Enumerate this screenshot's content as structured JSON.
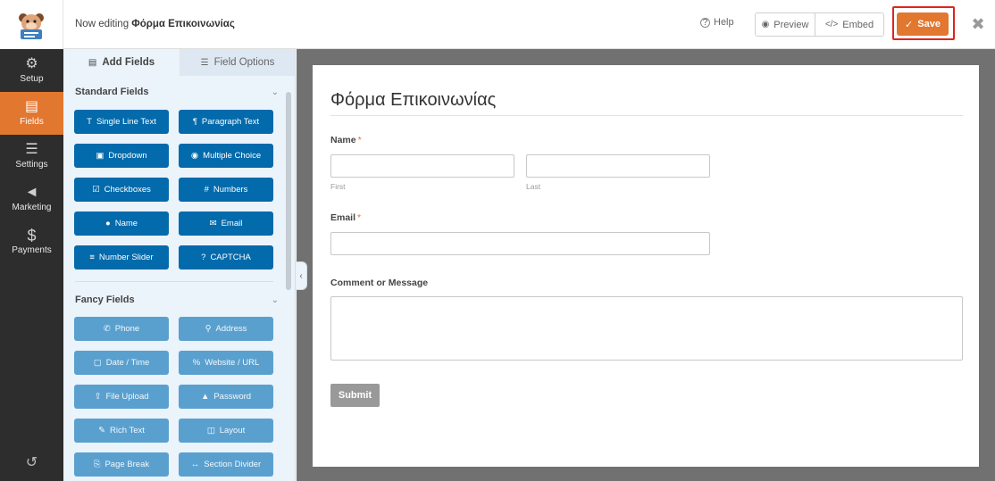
{
  "header": {
    "editing_prefix": "Now editing",
    "form_name": "Φόρμα Επικοινωνίας",
    "help_label": "Help",
    "preview_label": "Preview",
    "embed_label": "Embed",
    "save_label": "Save"
  },
  "sidebar": {
    "items": [
      {
        "label": "Setup",
        "icon": "gear-icon"
      },
      {
        "label": "Fields",
        "icon": "fields-icon",
        "active": true
      },
      {
        "label": "Settings",
        "icon": "sliders-icon"
      },
      {
        "label": "Marketing",
        "icon": "megaphone-icon"
      },
      {
        "label": "Payments",
        "icon": "dollar-icon"
      }
    ]
  },
  "panel": {
    "tabs": [
      {
        "label": "Add Fields",
        "icon": "list-icon"
      },
      {
        "label": "Field Options",
        "icon": "sliders-icon"
      }
    ],
    "standard_title": "Standard Fields",
    "standard_fields": [
      {
        "label": "Single Line Text",
        "icon": "text-icon",
        "glyph": "T"
      },
      {
        "label": "Paragraph Text",
        "icon": "paragraph-icon",
        "glyph": "¶"
      },
      {
        "label": "Dropdown",
        "icon": "dropdown-icon",
        "glyph": "▣"
      },
      {
        "label": "Multiple Choice",
        "icon": "radio-icon",
        "glyph": "◉"
      },
      {
        "label": "Checkboxes",
        "icon": "checkbox-icon",
        "glyph": "☑"
      },
      {
        "label": "Numbers",
        "icon": "hash-icon",
        "glyph": "#"
      },
      {
        "label": "Name",
        "icon": "user-icon",
        "glyph": "●"
      },
      {
        "label": "Email",
        "icon": "envelope-icon",
        "glyph": "✉"
      },
      {
        "label": "Number Slider",
        "icon": "slider-icon",
        "glyph": "≡"
      },
      {
        "label": "CAPTCHA",
        "icon": "question-icon",
        "glyph": "?"
      }
    ],
    "fancy_title": "Fancy Fields",
    "fancy_fields": [
      {
        "label": "Phone",
        "icon": "phone-icon",
        "glyph": "✆"
      },
      {
        "label": "Address",
        "icon": "map-pin-icon",
        "glyph": "⚲"
      },
      {
        "label": "Date / Time",
        "icon": "calendar-icon",
        "glyph": "▢"
      },
      {
        "label": "Website / URL",
        "icon": "link-icon",
        "glyph": "%"
      },
      {
        "label": "File Upload",
        "icon": "upload-icon",
        "glyph": "⇪"
      },
      {
        "label": "Password",
        "icon": "lock-icon",
        "glyph": "▲"
      },
      {
        "label": "Rich Text",
        "icon": "edit-icon",
        "glyph": "✎"
      },
      {
        "label": "Layout",
        "icon": "columns-icon",
        "glyph": "◫"
      },
      {
        "label": "Page Break",
        "icon": "pagebreak-icon",
        "glyph": "⎘"
      },
      {
        "label": "Section Divider",
        "icon": "divider-icon",
        "glyph": "↔"
      }
    ]
  },
  "form": {
    "title": "Φόρμα Επικοινωνίας",
    "name_label": "Name",
    "name_required": "*",
    "first_sublabel": "First",
    "last_sublabel": "Last",
    "email_label": "Email",
    "email_required": "*",
    "comment_label": "Comment or Message",
    "submit_label": "Submit"
  },
  "colors": {
    "accent": "#e27730",
    "field_button": "#036aab",
    "fancy_button": "#5aa0cf",
    "highlight": "#e2221f"
  }
}
